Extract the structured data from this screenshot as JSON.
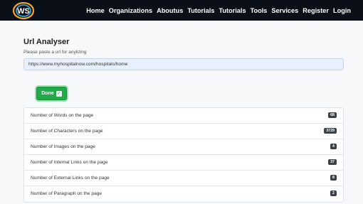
{
  "nav": {
    "logo_text": "WS",
    "links": [
      "Home",
      "Organizations",
      "Aboutus",
      "Tutorials",
      "Tutorials",
      "Tools",
      "Services",
      "Register",
      "Login"
    ]
  },
  "main": {
    "title": "Url Analyser",
    "hint": "Please paste a url for anylizing",
    "url_value": "https://www.myhospitalnow.com/hospitals/home",
    "done_label": "Done"
  },
  "results": [
    {
      "label": "Number of Words on the page",
      "count": "68"
    },
    {
      "label": "Number of Characters on the page",
      "count": "3729"
    },
    {
      "label": "Number of Images on the page",
      "count": "4"
    },
    {
      "label": "Number of Internal Links on the page",
      "count": "37"
    },
    {
      "label": "Number of External Links on the page",
      "count": "8"
    },
    {
      "label": "Number of Paragraph on the page",
      "count": "2"
    }
  ],
  "colors": {
    "navbar": "#0b0f18",
    "done_button": "#22a94a",
    "badge": "#3b4045",
    "input_bg": "#e8f0fe"
  }
}
